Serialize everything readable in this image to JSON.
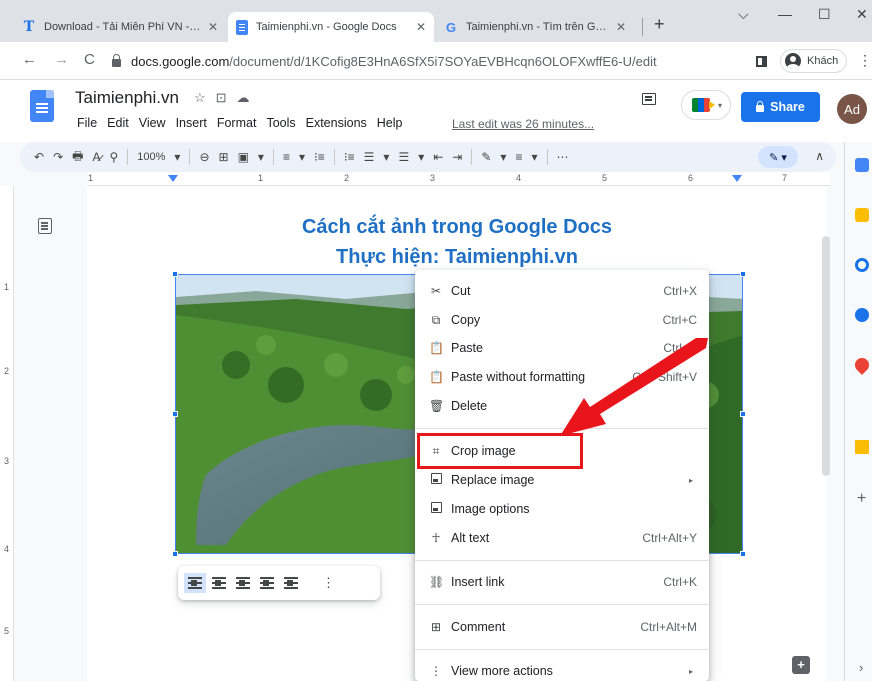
{
  "browser": {
    "tabs": [
      {
        "title": "Download - Tải Miễn Phí VN - Ph",
        "close": "✕"
      },
      {
        "title": "Taimienphi.vn - Google Docs",
        "close": "✕"
      },
      {
        "title": "Taimienphi.vn - Tìm trên Google",
        "close": "✕"
      }
    ],
    "new_tab": "+",
    "window_controls": {
      "dropdown": "⌵",
      "minimize": "—",
      "maximize": "☐",
      "close": "✕"
    },
    "nav": {
      "back": "←",
      "forward": "→",
      "reload": "C"
    },
    "url_host": "docs.google.com",
    "url_path": "/document/d/1KCofig8E3HnA6SfX5i7SOYaEVBHcqn6OLOFXwffE6-U/edit",
    "profile_label": "Khách",
    "menu_icon": "⋮"
  },
  "docs": {
    "title": "Taimienphi.vn",
    "title_icons": "☆⊡☁",
    "menu": [
      "File",
      "Edit",
      "View",
      "Insert",
      "Format",
      "Tools",
      "Extensions",
      "Help"
    ],
    "last_edit": "Last edit was 26 minutes...",
    "share_label": "Share",
    "account_initials": "Ad",
    "meet_caret": "▾"
  },
  "toolbar": {
    "items": [
      "↶",
      "↷",
      "🖶",
      "A̷",
      "⚲",
      "100%",
      "▾",
      "⊖",
      "⊞",
      "▣",
      "▾",
      "≡",
      "▾",
      "⁝≡",
      "⁝≡",
      "☰",
      "▾",
      "☰",
      "▾",
      "⇤",
      "⇥",
      "✎",
      "▾",
      "≡",
      "▾",
      "⋯"
    ],
    "zoom": "100%",
    "pen": "✎ ▾",
    "collapse": "∧"
  },
  "ruler": {
    "numbers": [
      "1",
      "1",
      "2",
      "3",
      "4",
      "5",
      "6",
      "7"
    ]
  },
  "vruler": {
    "numbers": [
      "1",
      "2",
      "3",
      "4",
      "5"
    ]
  },
  "document": {
    "heading_line1": "Cách cắt ảnh trong Google Docs",
    "heading_line2": "Thực hiện: Taimienphi.vn"
  },
  "image_toolbar": {
    "more": "⋮"
  },
  "context_menu": {
    "items": [
      {
        "icon": "✂",
        "label": "Cut",
        "shortcut": "Ctrl+X"
      },
      {
        "icon": "⧉",
        "label": "Copy",
        "shortcut": "Ctrl+C"
      },
      {
        "icon": "📋",
        "label": "Paste",
        "shortcut": "Ctrl+V"
      },
      {
        "icon": "📋",
        "label": "Paste without formatting",
        "shortcut": "Ctrl+Shift+V"
      },
      {
        "icon": "🗑",
        "label": "Delete",
        "shortcut": ""
      },
      {
        "icon": "⌗",
        "label": "Crop image",
        "shortcut": ""
      },
      {
        "icon": "",
        "label": "Replace image",
        "shortcut": "",
        "arrow": "▸"
      },
      {
        "icon": "",
        "label": "Image options",
        "shortcut": ""
      },
      {
        "icon": "☥",
        "label": "Alt text",
        "shortcut": "Ctrl+Alt+Y"
      },
      {
        "icon": "⛓",
        "label": "Insert link",
        "shortcut": "Ctrl+K"
      },
      {
        "icon": "⊞",
        "label": "Comment",
        "shortcut": "Ctrl+Alt+M"
      },
      {
        "icon": "⋮",
        "label": "View more actions",
        "shortcut": "",
        "arrow": "▸"
      }
    ]
  },
  "side_panel": {
    "plus": "+",
    "chevron": "›",
    "explore": "+"
  },
  "colors": {
    "accent": "#1a73e8",
    "highlight": "#e8151b",
    "heading": "#1f6fc4"
  }
}
